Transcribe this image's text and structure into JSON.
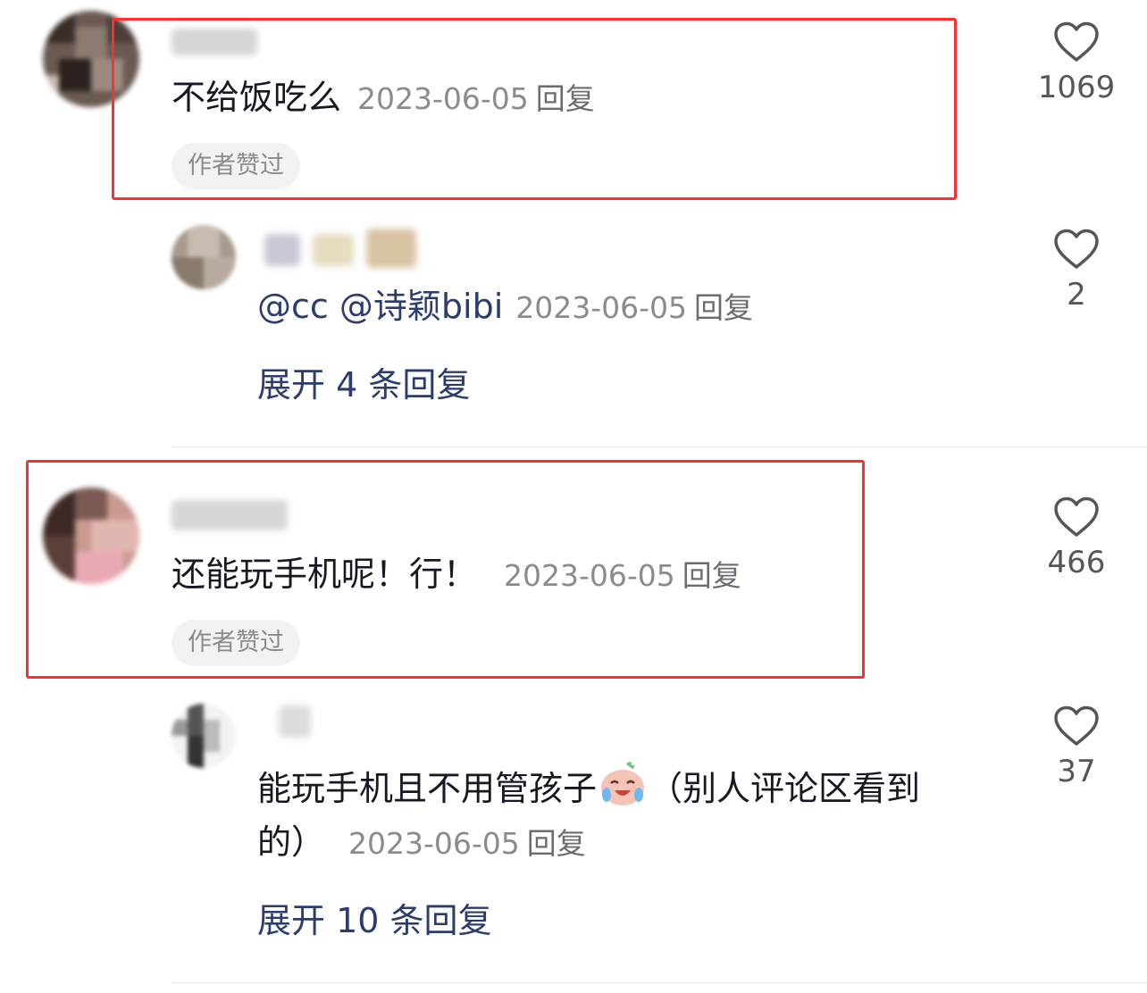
{
  "colors": {
    "highlight": "#ff2d2d",
    "link": "#2b3d6f",
    "meta": "#8a8b91"
  },
  "comments": [
    {
      "text": "不给饭吃么",
      "date": "2023-06-05",
      "reply_label": "回复",
      "badge": "作者赞过",
      "likes": "1069",
      "like_icon": "heart-icon",
      "reply": {
        "mention1": "@cc",
        "mention2": "@诗颖bibi",
        "date": "2023-06-05",
        "reply_label": "回复",
        "likes": "2",
        "expand": "展开 4 条回复"
      }
    },
    {
      "text": "还能玩手机呢！行！",
      "date": "2023-06-05",
      "reply_label": "回复",
      "badge": "作者赞过",
      "likes": "466",
      "like_icon": "heart-icon",
      "reply": {
        "text_line1": "能玩手机且不用管孩子",
        "emoji": "crying-laughing-emoji",
        "text_line1_tail": "（别人评论区看到",
        "text_line2": "的）",
        "date": "2023-06-05",
        "reply_label": "回复",
        "likes": "37",
        "expand": "展开 10 条回复"
      }
    }
  ]
}
